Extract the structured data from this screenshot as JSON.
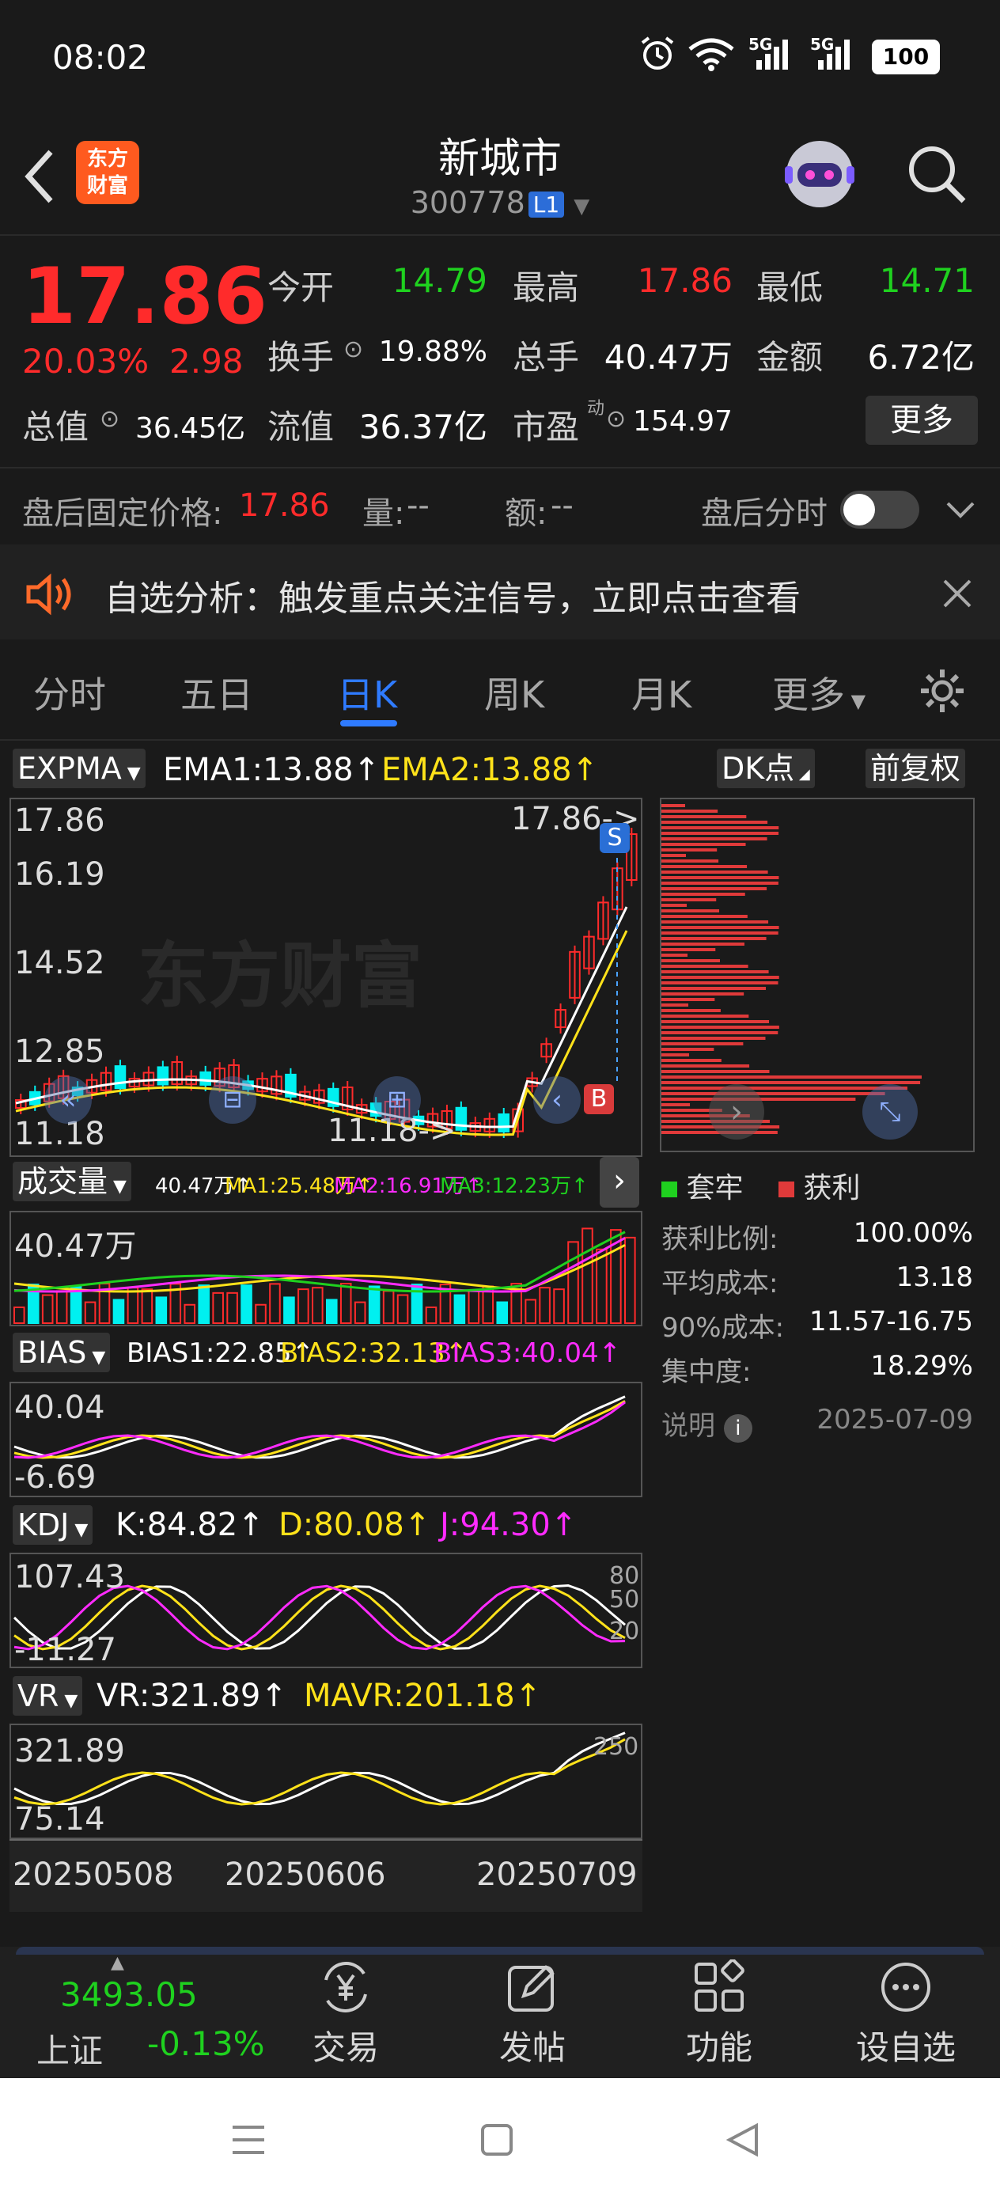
{
  "status_bar": {
    "time": "08:02",
    "signal1_label": "5G",
    "signal2_label": "5G",
    "battery": "100"
  },
  "header": {
    "logo_line1": "东方",
    "logo_line2": "财富",
    "title": "新城市",
    "code": "300778",
    "level_badge": "L1"
  },
  "quote": {
    "price": "17.86",
    "change_pct": "20.03%",
    "change_amt": "2.98",
    "open_label": "今开",
    "open": "14.79",
    "high_label": "最高",
    "high": "17.86",
    "low_label": "最低",
    "low": "14.71",
    "turnover_label": "换手",
    "turnover": "19.88%",
    "volume_label": "总手",
    "volume": "40.47万",
    "amount_label": "金额",
    "amount": "6.72亿",
    "mktcap_label": "总值",
    "mktcap": "36.45亿",
    "float_label": "流值",
    "float": "36.37亿",
    "pe_label": "市盈",
    "pe_sup": "动",
    "pe": "154.97",
    "more_button": "更多"
  },
  "after_hours": {
    "price_label": "盘后固定价格:",
    "price": "17.86",
    "vol_label": "量:",
    "vol": "--",
    "amt_label": "额:",
    "amt": "--",
    "toggle_label": "盘后分时"
  },
  "banner": {
    "text": "自选分析：触发重点关注信号，立即点击查看"
  },
  "tabs": [
    {
      "label": "分时"
    },
    {
      "label": "五日"
    },
    {
      "label": "日K"
    },
    {
      "label": "周K"
    },
    {
      "label": "月K"
    },
    {
      "label": "更多"
    }
  ],
  "main_chart": {
    "indicator": "EXPMA",
    "ema1": "EMA1:13.88",
    "ema2": "EMA2:13.88",
    "dk_button": "DK点",
    "adjust_button": "前复权",
    "y_labels": [
      "17.86",
      "16.19",
      "14.52",
      "12.85",
      "11.18"
    ],
    "max_marker": "17.86->",
    "min_marker": "11.18->",
    "sell_badge": "S",
    "buy_badge": "B",
    "watermark": "东方财富"
  },
  "volume_chart": {
    "indicator": "成交量",
    "value": "40.47万",
    "ma1": "MA1:25.48万",
    "ma2": "MA2:16.91万",
    "ma3": "MA3:12.23万",
    "y_label": "40.47万"
  },
  "bias_chart": {
    "indicator": "BIAS",
    "b1": "BIAS1:22.85",
    "b2": "BIAS2:32.13",
    "b3": "BIAS3:40.04",
    "y_top": "40.04",
    "y_bottom": "-6.69"
  },
  "kdj_chart": {
    "indicator": "KDJ",
    "k": "K:84.82",
    "d": "D:80.08",
    "j": "J:94.30",
    "y_top": "107.43",
    "y_bottom": "-11.27",
    "r80": "80",
    "r50": "50",
    "r20": "20"
  },
  "vr_chart": {
    "indicator": "VR",
    "vr": "VR:321.89",
    "mavr": "MAVR:201.18",
    "y_top": "321.89",
    "y_bottom": "75.14",
    "r_top": "250"
  },
  "dates": [
    "20250508",
    "20250606",
    "20250709"
  ],
  "chip": {
    "legend_trapped": "套牢",
    "legend_profit": "获利",
    "rows": [
      {
        "label": "获利比例:",
        "value": "100.00%"
      },
      {
        "label": "平均成本:",
        "value": "13.18"
      },
      {
        "label": "90%成本:",
        "value": "11.57-16.75"
      },
      {
        "label": "集中度:",
        "value": "18.29%"
      }
    ],
    "note_label": "说明",
    "date": "2025-07-09"
  },
  "bottom_nav": {
    "index_value": "3493.05",
    "index_name": "上证",
    "index_change": "-0.13%",
    "items": [
      {
        "label": "交易"
      },
      {
        "label": "发帖"
      },
      {
        "label": "功能"
      },
      {
        "label": "设自选"
      }
    ]
  },
  "colors": {
    "up": "#ff2b2b",
    "down": "#1fd11f",
    "ema2": "#ffe21a",
    "ma2": "#ff2bff",
    "cyan_bar": "#00f0f0",
    "accent": "#2f7bff"
  }
}
